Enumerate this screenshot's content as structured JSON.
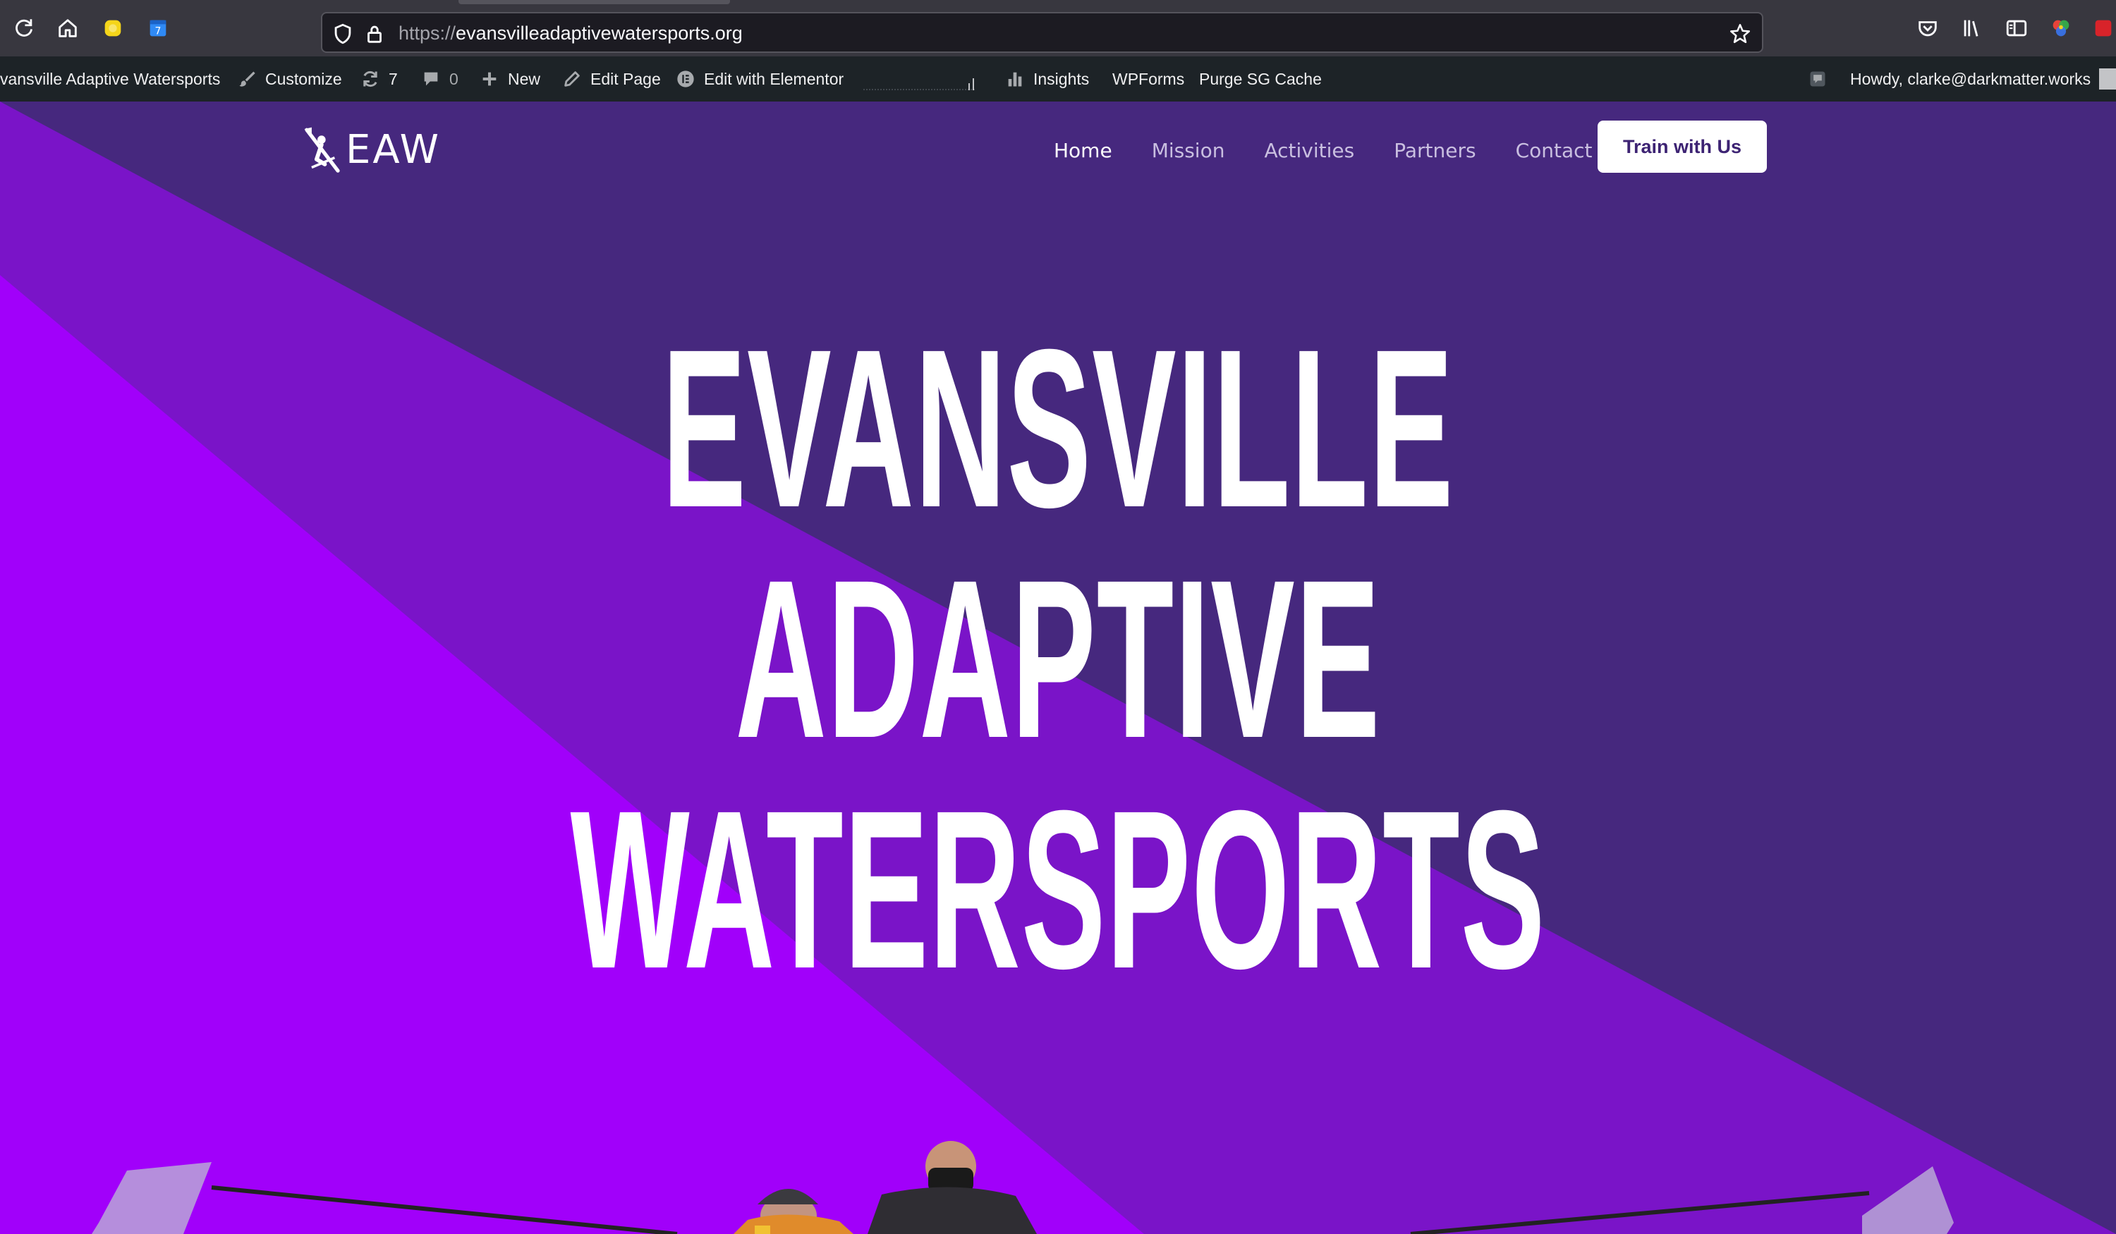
{
  "browser": {
    "url_scheme": "https://",
    "url_host": "evansvilleadaptivewatersports.org"
  },
  "admin_bar": {
    "site_name": "vansville Adaptive Watersports",
    "customize": "Customize",
    "updates_count": "7",
    "comments_count": "0",
    "new": "New",
    "edit_page": "Edit Page",
    "edit_elementor": "Edit with Elementor",
    "insights": "Insights",
    "wpforms": "WPForms",
    "purge_cache": "Purge SG Cache",
    "howdy": "Howdy, clarke@darkmatter.works"
  },
  "site": {
    "logo_text": "EAW",
    "nav": [
      "Home",
      "Mission",
      "Activities",
      "Partners",
      "Contact"
    ],
    "active_nav": "Home",
    "cta": "Train with Us",
    "hero_lines": [
      "EVANSVILLE",
      "ADAPTIVE",
      "WATERSPORTS"
    ],
    "colors": {
      "dark_purple": "#46287e",
      "mid_purple": "#7a14c8",
      "bright_purple": "#a100fa",
      "admin_bar": "#1d2327"
    }
  },
  "icons": {
    "reload": "reload-icon",
    "home": "home-icon",
    "shield": "tracking-protection-icon",
    "lock": "lock-icon",
    "bookmark": "bookmark-star-icon",
    "pocket": "pocket-icon",
    "library": "library-icon",
    "sidebar": "sidebar-icon"
  }
}
